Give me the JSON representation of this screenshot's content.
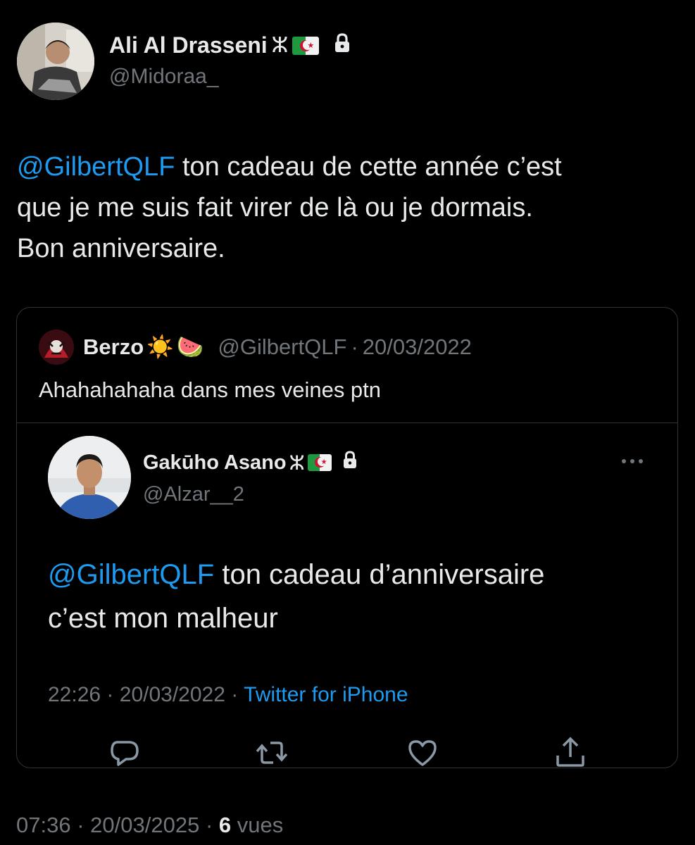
{
  "author": {
    "name": "Ali Al Drasseni",
    "name_glyph": "ⵣ",
    "handle": "@Midoraa_"
  },
  "tweet": {
    "mention": "@GilbertQLF",
    "text_line1": " ton cadeau de cette année c’est",
    "text_line2": "que je me suis fait virer de là ou je dormais.",
    "text_line3": "Bon anniversaire."
  },
  "quoted": {
    "name": "Berzo",
    "emoji_sun": "☀️",
    "emoji_melon": "🍉",
    "handle": "@GilbertQLF",
    "separator": "·",
    "date": "20/03/2022",
    "text": "Ahahahahaha dans mes veines ptn"
  },
  "embedded": {
    "name": "Gakūho Asano",
    "name_glyph": "ⵣ",
    "handle": "@Alzar__2",
    "mention": "@GilbertQLF",
    "text_line1": " ton cadeau d’anniversaire",
    "text_line2": "c’est mon malheur",
    "time": "22:26",
    "date": "20/03/2022",
    "separator": "·",
    "source": "Twitter for iPhone"
  },
  "footer": {
    "time": "07:36",
    "separator": "·",
    "date": "20/03/2025",
    "view_count": "6",
    "view_label": "vues"
  },
  "colors": {
    "background": "#000000",
    "text": "#e7e9ea",
    "muted": "#71767b",
    "link": "#1d9bf0",
    "border": "#2f3336"
  }
}
